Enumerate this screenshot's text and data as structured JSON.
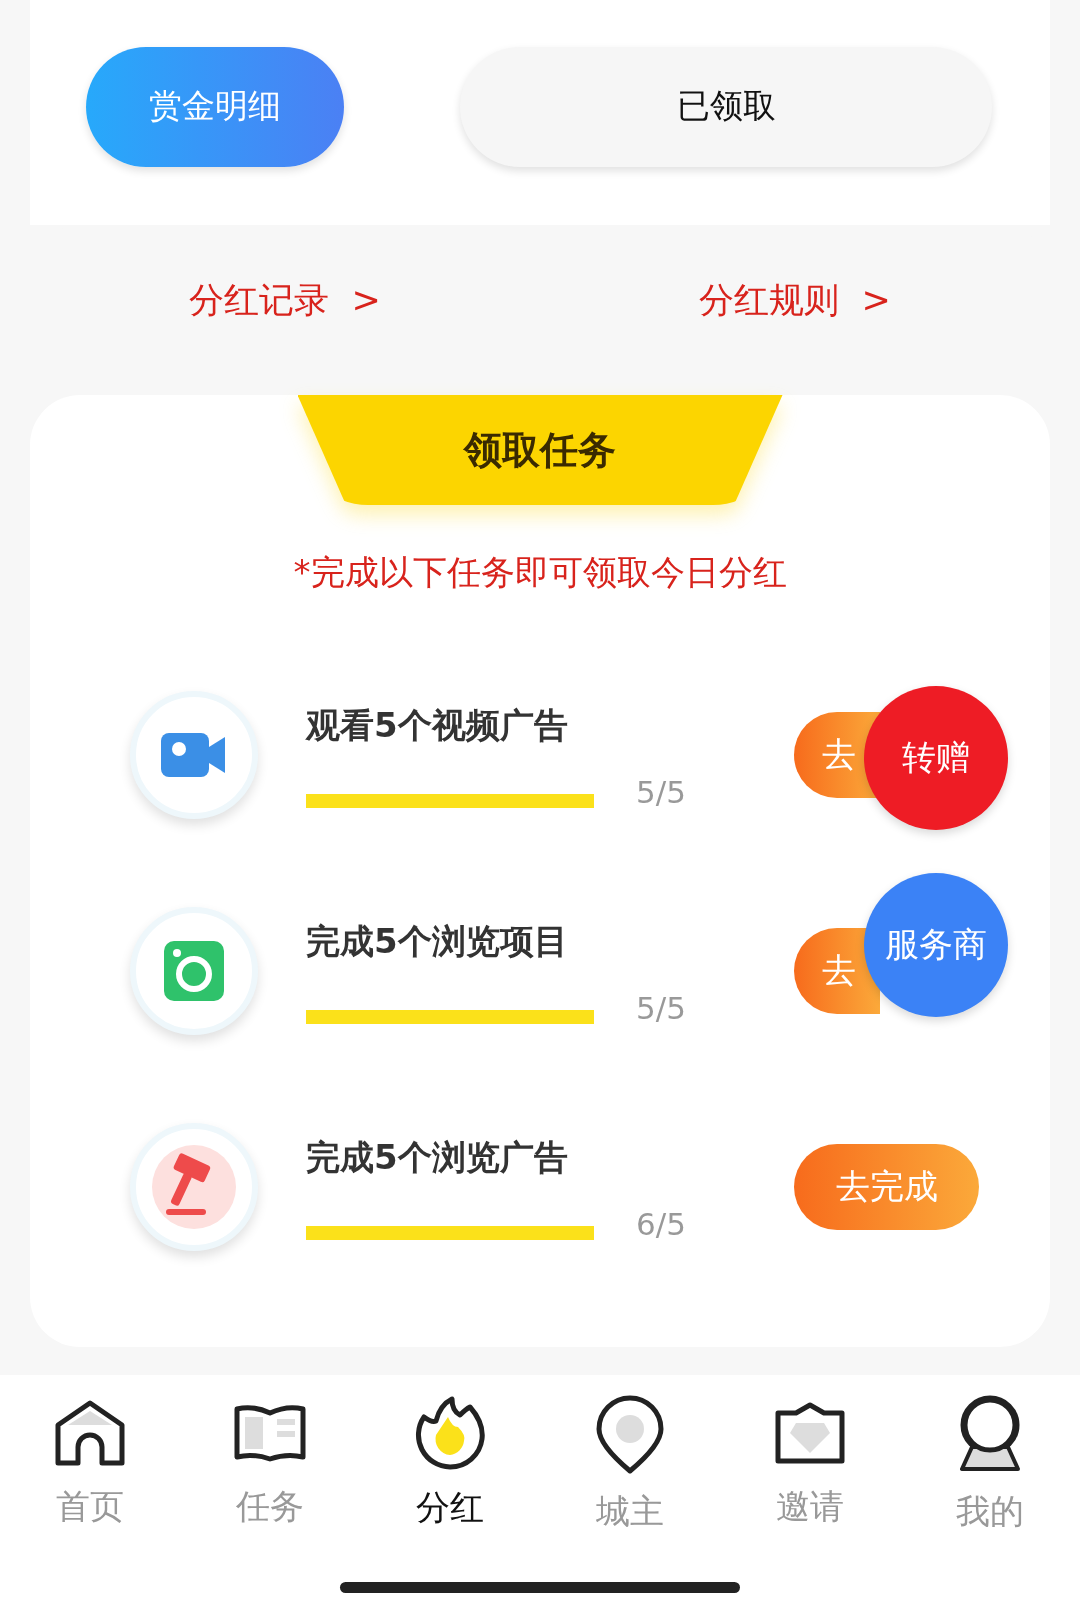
{
  "top_buttons": [
    {
      "label": "赏金明细",
      "selected": true
    },
    {
      "label": "已领取",
      "selected": false
    }
  ],
  "links": [
    {
      "label": "分红记录",
      "arrow": ">"
    },
    {
      "label": "分红规则",
      "arrow": ">"
    }
  ],
  "task_panel": {
    "title": "领取任务",
    "subtitle": "*完成以下任务即可领取今日分红",
    "tasks": [
      {
        "kind": "video",
        "title": "观看5个视频广告",
        "level": 1,
        "count": "5/5",
        "button": "去"
      },
      {
        "kind": "camera",
        "title": "完成5个浏览项目",
        "level": 1,
        "count": "5/5",
        "button": "去"
      },
      {
        "kind": "gavel",
        "title": "完成5个浏览广告",
        "level": 1,
        "count": "6/5",
        "button": "去完成"
      }
    ]
  },
  "floating_buttons": [
    {
      "label": "转赠",
      "color": "#ee1c25"
    },
    {
      "label": "服务商",
      "color": "#3b82f6"
    }
  ],
  "tab_bar": [
    {
      "kind": "home",
      "label": "首页",
      "selected": false
    },
    {
      "kind": "book",
      "label": "任务",
      "selected": false
    },
    {
      "kind": "flame",
      "label": "分红",
      "selected": true
    },
    {
      "kind": "pin",
      "label": "城主",
      "selected": false
    },
    {
      "kind": "crown",
      "label": "邀请",
      "selected": false
    },
    {
      "kind": "person",
      "label": "我的",
      "selected": false
    }
  ]
}
